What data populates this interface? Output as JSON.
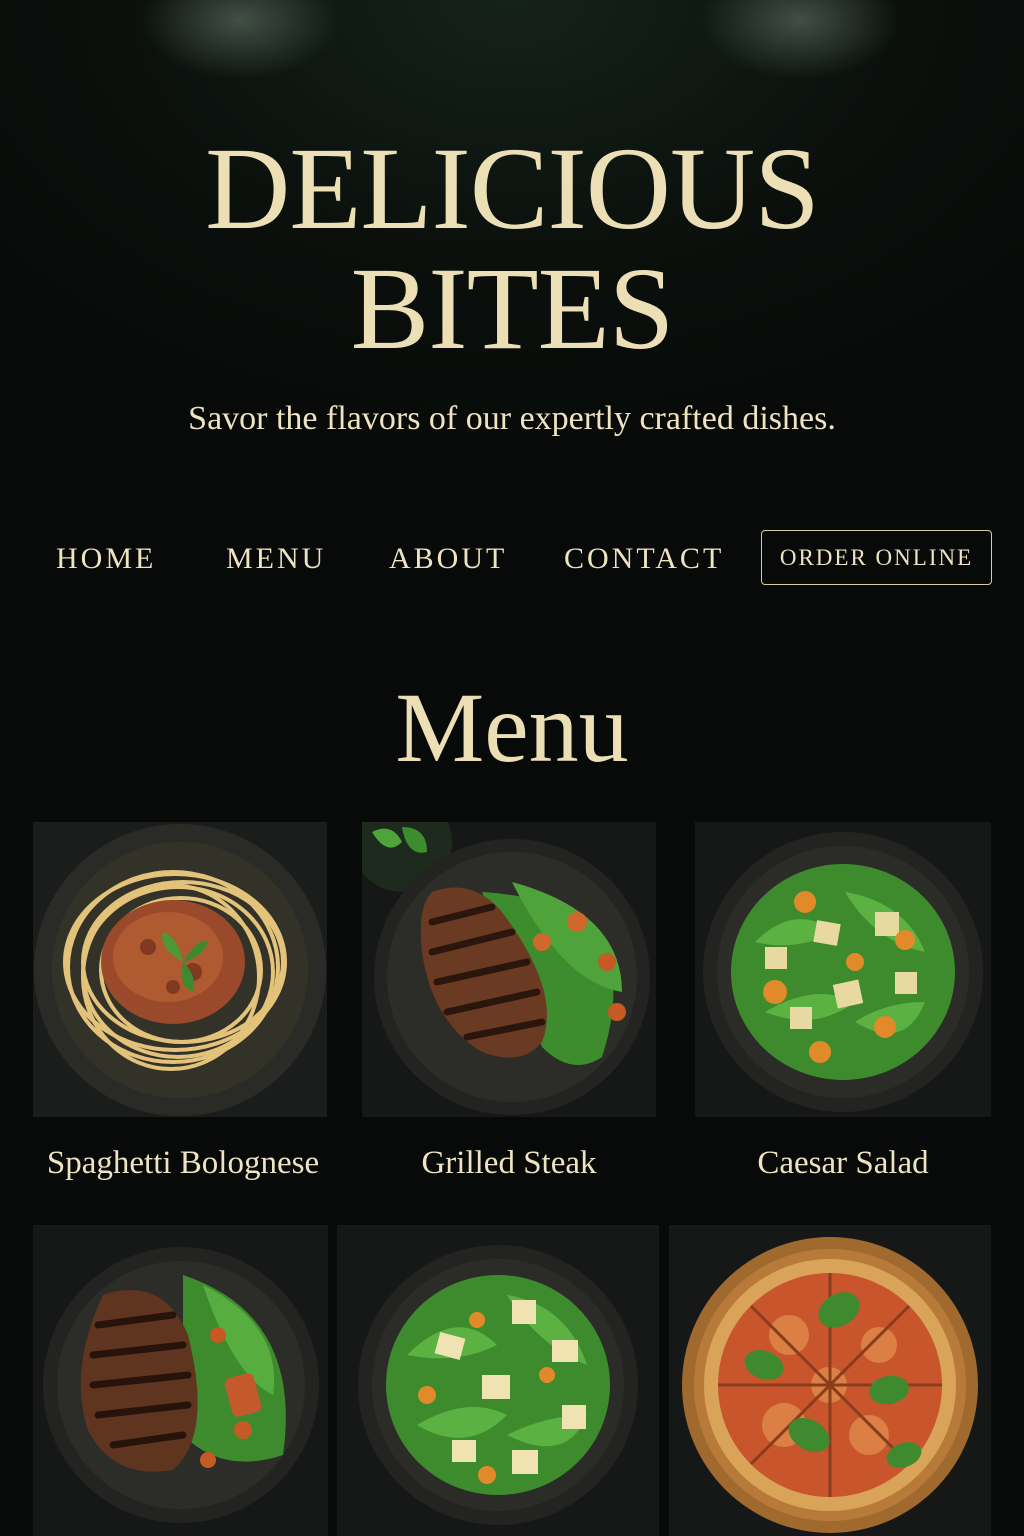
{
  "header": {
    "title_line1": "DELICIOUS",
    "title_line2": "BITES",
    "tagline": "Savor the flavors of our expertly crafted dishes."
  },
  "nav": {
    "items": [
      {
        "label": "HOME"
      },
      {
        "label": "MENU"
      },
      {
        "label": "ABOUT"
      },
      {
        "label": "CONTACT"
      }
    ],
    "order_label": "ORDER ONLINE"
  },
  "menu": {
    "heading": "Menu",
    "items": [
      {
        "name": "Spaghetti Bolognese",
        "image": "spaghetti-bolognese-photo"
      },
      {
        "name": "Grilled Steak",
        "image": "grilled-steak-photo"
      },
      {
        "name": "Caesar Salad",
        "image": "caesar-salad-photo"
      },
      {
        "name": "",
        "image": "grilled-steak-salad-photo"
      },
      {
        "name": "",
        "image": "caesar-salad-photo"
      },
      {
        "name": "",
        "image": "margherita-pizza-photo"
      }
    ]
  },
  "colors": {
    "background": "#090d0b",
    "accent_cream": "#ecdfb6"
  }
}
